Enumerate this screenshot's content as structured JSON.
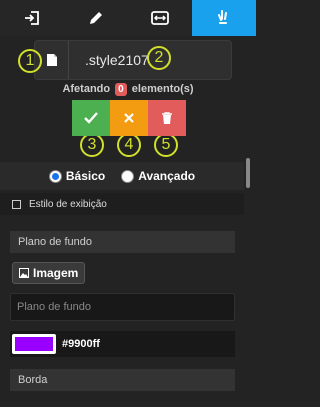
{
  "toolbar": {
    "items": [
      {
        "icon": "enter-icon"
      },
      {
        "icon": "pencil-icon"
      },
      {
        "icon": "resize-horizontal-icon"
      },
      {
        "icon": "hand-pointer-icon",
        "active": true
      }
    ]
  },
  "selector": {
    "class_name": ".style2107"
  },
  "markers": [
    "1",
    "2",
    "3",
    "4",
    "5"
  ],
  "affecting": {
    "prefix": "Afetando",
    "count": "0",
    "suffix": "elemento(s)"
  },
  "mode": {
    "basic": "Básico",
    "advanced": "Avançado",
    "selected": "basic"
  },
  "display_style": {
    "label": "Estilo de exibição"
  },
  "background": {
    "section_title": "Plano de fundo",
    "image_button": "Imagem",
    "input_placeholder": "Plano de fundo",
    "color_value": "#9900ff"
  },
  "border": {
    "section_title": "Borda"
  },
  "colors": {
    "accent": "#1aa1ee",
    "ok": "#4caf50",
    "cancel": "#f39c12",
    "delete": "#e25c5c",
    "marker": "#d1e02a",
    "swatch": "#9900ff"
  }
}
